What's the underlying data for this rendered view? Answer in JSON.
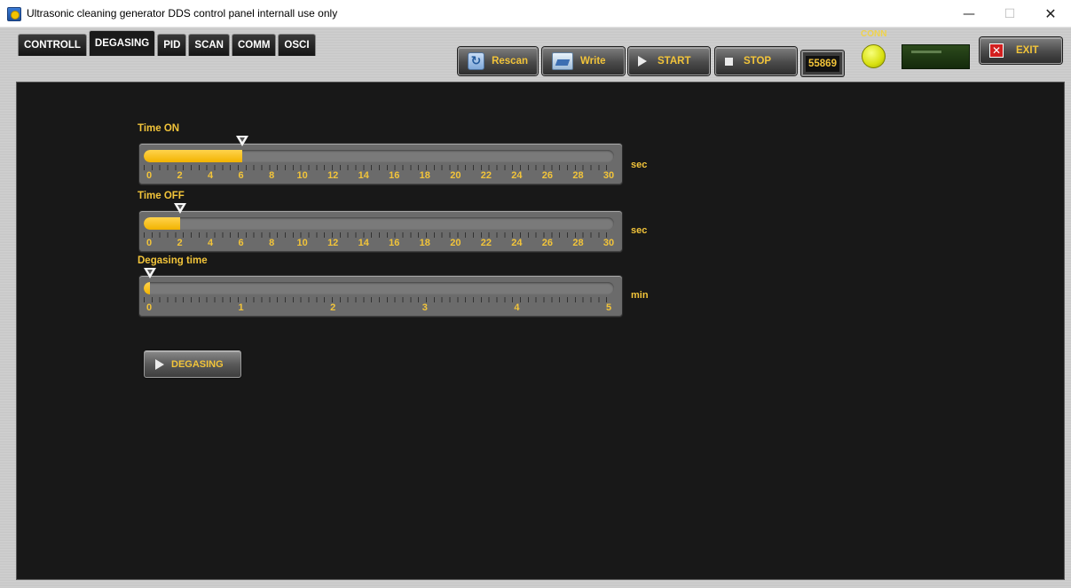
{
  "window": {
    "title": "Ultrasonic cleaning generator DDS control panel internall use only",
    "minimize_glyph": "—",
    "maximize_glyph": "☐",
    "close_glyph": "✕"
  },
  "tabs": [
    {
      "label": "CONTROLL",
      "active": false
    },
    {
      "label": "DEGASING",
      "active": true
    },
    {
      "label": "PID",
      "active": false
    },
    {
      "label": "SCAN",
      "active": false
    },
    {
      "label": "COMM",
      "active": false
    },
    {
      "label": "OSCI",
      "active": false
    }
  ],
  "toolbar": {
    "rescan_label": "Rescan",
    "write_label": "Write",
    "start_label": "START",
    "stop_label": "STOP",
    "counter_value": "55869",
    "conn_label": "CONN",
    "conn_led_color": "#e1e80f",
    "exit_label": "EXIT",
    "exit_glyph": "✕"
  },
  "degasing": {
    "sliders": [
      {
        "label": "Time ON",
        "unit": "sec",
        "min": 0,
        "max": 30,
        "value": 6.3,
        "ticks": [
          "0",
          "2",
          "4",
          "6",
          "8",
          "10",
          "12",
          "14",
          "16",
          "18",
          "20",
          "22",
          "24",
          "26",
          "28",
          "30"
        ]
      },
      {
        "label": "Time OFF",
        "unit": "sec",
        "min": 0,
        "max": 30,
        "value": 2.3,
        "ticks": [
          "0",
          "2",
          "4",
          "6",
          "8",
          "10",
          "12",
          "14",
          "16",
          "18",
          "20",
          "22",
          "24",
          "26",
          "28",
          "30"
        ]
      },
      {
        "label": "Degasing time",
        "unit": "min",
        "min": 0,
        "max": 5,
        "value": 0.02,
        "ticks": [
          "0",
          "1",
          "2",
          "3",
          "4",
          "5"
        ]
      }
    ],
    "degasing_button_label": "DEGASING"
  },
  "colors": {
    "accent": "#f2c43a",
    "fill": "#f2b300",
    "panel_bg": "#181818"
  }
}
